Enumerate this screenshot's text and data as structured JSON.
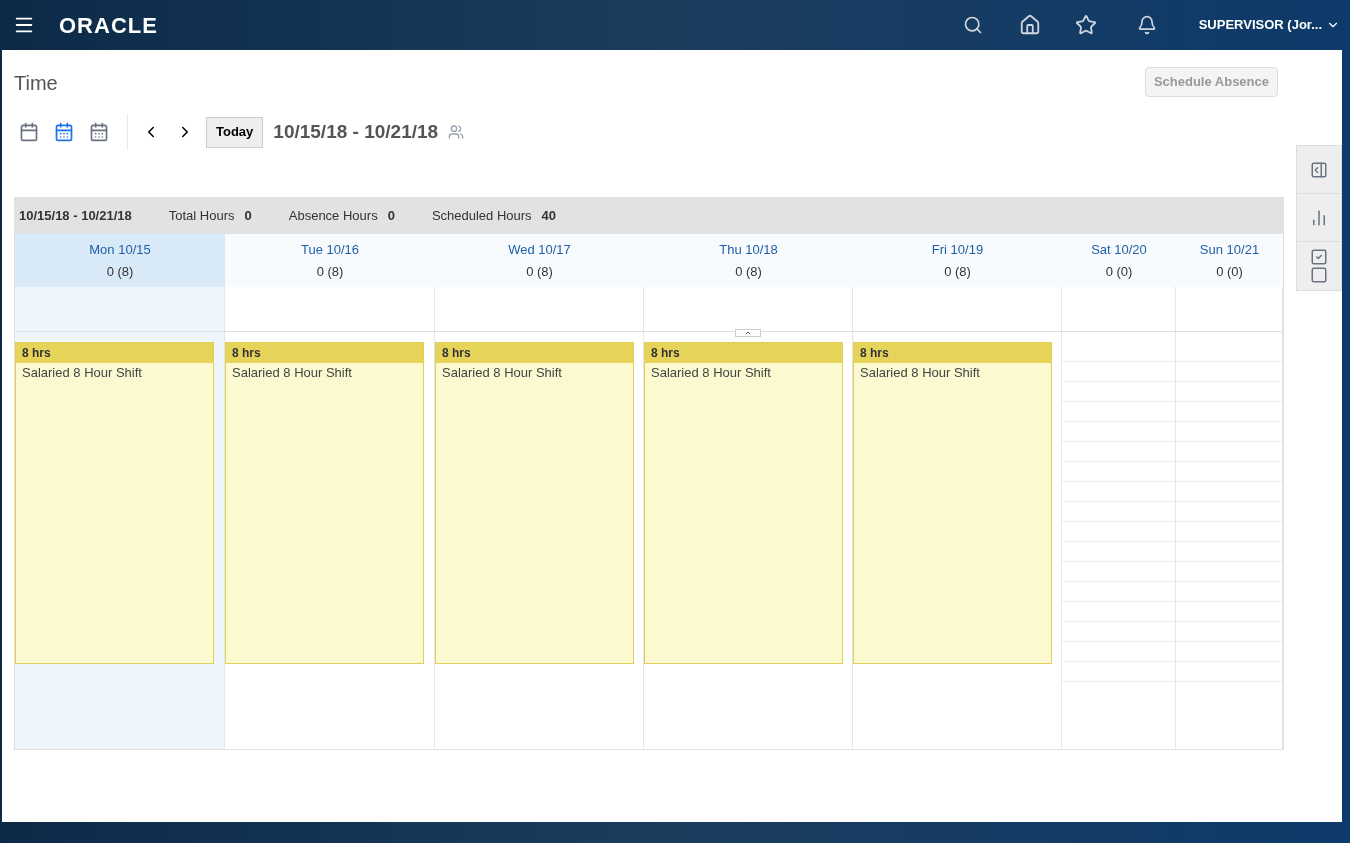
{
  "header": {
    "logo": "ORACLE",
    "user": "SUPERVISOR (Jor..."
  },
  "page": {
    "title": "Time",
    "action": "Schedule Absence"
  },
  "toolbar": {
    "views": [
      {
        "kind": "day",
        "selected": false
      },
      {
        "kind": "week",
        "selected": true
      },
      {
        "kind": "month",
        "selected": false
      }
    ],
    "today": "Today",
    "range": "10/15/18 - 10/21/18"
  },
  "summary": {
    "range": "10/15/18 - 10/21/18",
    "items": [
      {
        "label": "Total Hours",
        "value": "0"
      },
      {
        "label": "Absence Hours",
        "value": "0"
      },
      {
        "label": "Scheduled Hours",
        "value": "40"
      }
    ]
  },
  "days": [
    {
      "label": "Mon 10/15",
      "hours": "0 (8)",
      "selected": true,
      "shift": {
        "hours": "8 hrs",
        "name": "Salaried 8 Hour Shift"
      }
    },
    {
      "label": "Tue 10/16",
      "hours": "0 (8)",
      "selected": false,
      "shift": {
        "hours": "8 hrs",
        "name": "Salaried 8 Hour Shift"
      }
    },
    {
      "label": "Wed 10/17",
      "hours": "0 (8)",
      "selected": false,
      "shift": {
        "hours": "8 hrs",
        "name": "Salaried 8 Hour Shift"
      }
    },
    {
      "label": "Thu 10/18",
      "hours": "0 (8)",
      "selected": false,
      "shift": {
        "hours": "8 hrs",
        "name": "Salaried 8 Hour Shift"
      }
    },
    {
      "label": "Fri 10/19",
      "hours": "0 (8)",
      "selected": false,
      "shift": {
        "hours": "8 hrs",
        "name": "Salaried 8 Hour Shift"
      }
    },
    {
      "label": "Sat 10/20",
      "hours": "0 (0)",
      "selected": false
    },
    {
      "label": "Sun 10/21",
      "hours": "0 (0)",
      "selected": false
    }
  ]
}
